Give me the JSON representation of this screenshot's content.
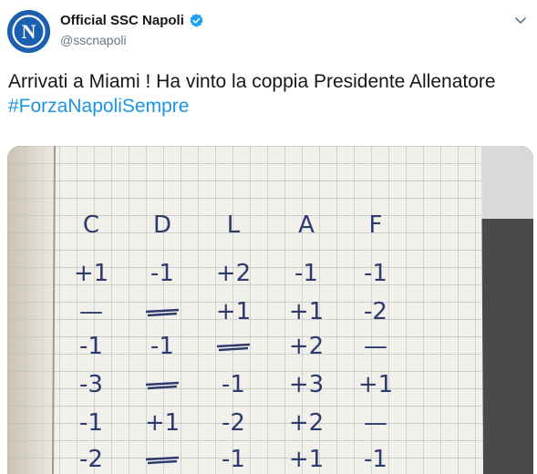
{
  "tweet": {
    "display_name": "Official SSC Napoli",
    "handle": "@sscnapoli",
    "text_main": "Arrivati a Miami ! Ha vinto la coppia Presidente Allenatore ",
    "hashtag": "#ForzaNapoliSempre",
    "avatar_letter": "N",
    "icons": {
      "verified": "verified-badge-icon",
      "menu": "chevron-down-icon"
    },
    "colors": {
      "link": "#1b95e0",
      "verified": "#1da1f2",
      "avatar": "#1a5fb0"
    }
  },
  "media": {
    "headers": [
      "C",
      "D",
      "L",
      "A",
      "F"
    ],
    "rows": [
      [
        "+1",
        "-1",
        "+2",
        "-1",
        "-1"
      ],
      [
        "—",
        "",
        "+1",
        "+1",
        "-2"
      ],
      [
        "-1",
        "-1",
        "",
        "+2",
        "—"
      ],
      [
        "-3",
        "",
        "-1",
        "+3",
        "+1"
      ],
      [
        "-1",
        "+1",
        "-2",
        "+2",
        "—"
      ],
      [
        "-2",
        "",
        "-1",
        "+1",
        "-1"
      ]
    ]
  }
}
